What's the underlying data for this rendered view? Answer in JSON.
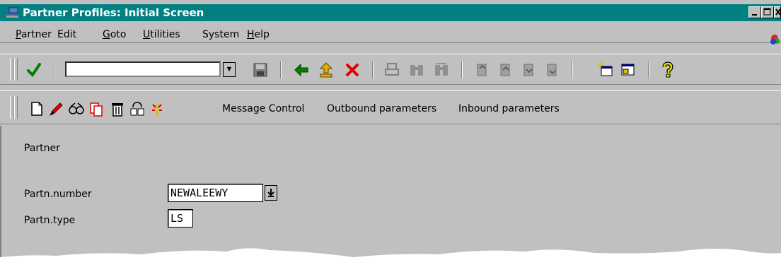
{
  "window": {
    "title": "Partner Profiles: Initial Screen"
  },
  "menu": {
    "items": [
      {
        "label": "Partner",
        "u": "P",
        "rest": "artner"
      },
      {
        "label": "Edit",
        "u": "",
        "rest": "Edit"
      },
      {
        "label": "Goto",
        "u": "G",
        "rest": "oto"
      },
      {
        "label": "Utilities",
        "u": "U",
        "rest": "tilities"
      },
      {
        "label": "System",
        "u": "",
        "rest": "System"
      },
      {
        "label": "Help",
        "u": "H",
        "rest": "elp"
      }
    ]
  },
  "toolbar2": {
    "message_control": "Message Control",
    "outbound": "Outbound parameters",
    "inbound": "Inbound parameters"
  },
  "form": {
    "group_title": "Partner",
    "partner_number_label": "Partn.number",
    "partner_number_value": "NEWALEEWY",
    "partner_type_label": "Partn.type",
    "partner_type_value": "LS"
  },
  "colors": {
    "titlebar": "#008080",
    "window": "#c0c0c0"
  },
  "icons": [
    "check-icon",
    "save-icon",
    "back-icon",
    "exit-icon",
    "cancel-icon",
    "print-icon",
    "find-icon",
    "find-next-icon",
    "first-page-icon",
    "prev-page-icon",
    "next-page-icon",
    "last-page-icon",
    "create-session-icon",
    "shortcut-icon",
    "help-icon",
    "create-icon",
    "change-icon",
    "display-icon",
    "copy-icon",
    "delete-icon",
    "check-partner-icon",
    "trace-icon"
  ]
}
